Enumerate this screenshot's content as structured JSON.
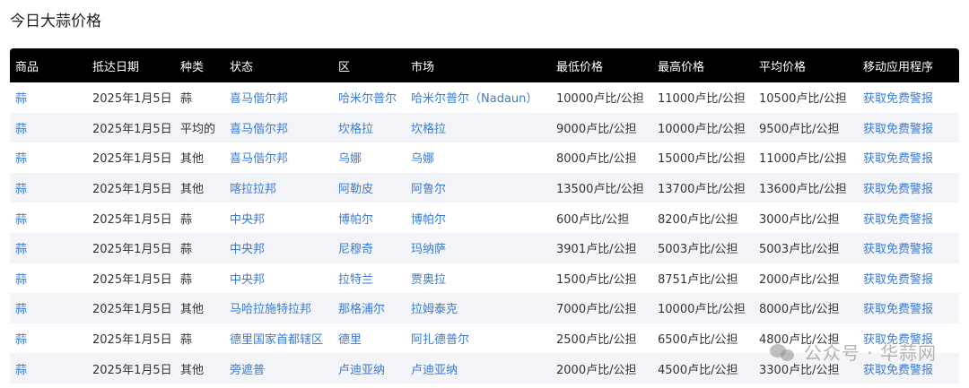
{
  "page": {
    "title": "今日大蒜价格"
  },
  "table": {
    "headers": [
      "商品",
      "抵达日期",
      "种类",
      "状态",
      "区",
      "市场",
      "最低价格",
      "最高价格",
      "平均价格",
      "移动应用程序"
    ],
    "rows": [
      [
        "蒜",
        "2025年1月5日",
        "蒜",
        "喜马偕尔邦",
        "哈米尔普尔",
        "哈米尔普尔（Nadaun）",
        "10000卢比/公担",
        "11000卢比/公担",
        "10500卢比/公担",
        "获取免费警报"
      ],
      [
        "蒜",
        "2025年1月5日",
        "平均的",
        "喜马偕尔邦",
        "坎格拉",
        "坎格拉",
        "9000卢比/公担",
        "10000卢比/公担",
        "9500卢比/公担",
        "获取免费警报"
      ],
      [
        "蒜",
        "2025年1月5日",
        "其他",
        "喜马偕尔邦",
        "乌娜",
        "乌娜",
        "8000卢比/公担",
        "15000卢比/公担",
        "11000卢比/公担",
        "获取免费警报"
      ],
      [
        "蒜",
        "2025年1月5日",
        "其他",
        "喀拉拉邦",
        "阿勒皮",
        "阿鲁尔",
        "13500卢比/公担",
        "13700卢比/公担",
        "13600卢比/公担",
        "获取免费警报"
      ],
      [
        "蒜",
        "2025年1月5日",
        "蒜",
        "中央邦",
        "博帕尔",
        "博帕尔",
        "600卢比/公担",
        "8200卢比/公担",
        "3000卢比/公担",
        "获取免费警报"
      ],
      [
        "蒜",
        "2025年1月5日",
        "蒜",
        "中央邦",
        "尼穆奇",
        "玛纳萨",
        "3901卢比/公担",
        "5003卢比/公担",
        "5003卢比/公担",
        "获取免费警报"
      ],
      [
        "蒜",
        "2025年1月5日",
        "蒜",
        "中央邦",
        "拉特兰",
        "贾奥拉",
        "1500卢比/公担",
        "8751卢比/公担",
        "2000卢比/公担",
        "获取免费警报"
      ],
      [
        "蒜",
        "2025年1月5日",
        "其他",
        "马哈拉施特拉邦",
        "那格浦尔",
        "拉姆泰克",
        "7000卢比/公担",
        "10000卢比/公担",
        "8000卢比/公担",
        "获取免费警报"
      ],
      [
        "蒜",
        "2025年1月5日",
        "蒜",
        "德里国家首都辖区",
        "德里",
        "阿扎德普尔",
        "2500卢比/公担",
        "6500卢比/公担",
        "4800卢比/公担",
        "获取免费警报"
      ],
      [
        "蒜",
        "2025年1月5日",
        "其他",
        "旁遮普",
        "卢迪亚纳",
        "卢迪亚纳",
        "2000卢比/公担",
        "4500卢比/公担",
        "3300卢比/公担",
        "获取免费警报"
      ]
    ]
  },
  "watermark": {
    "text": "公众号 · 华蒜网"
  },
  "colors": {
    "header_bg": "#000000",
    "link": "#3a7bd5",
    "stripe": "#f2f4f7"
  }
}
